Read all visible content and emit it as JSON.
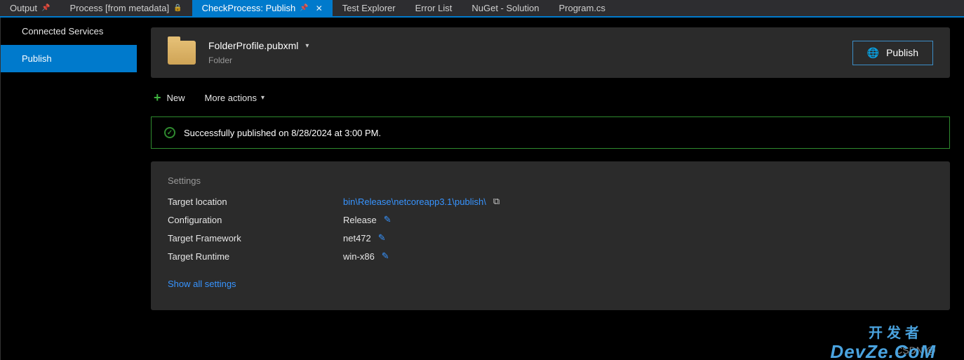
{
  "tabs": {
    "output": "Output",
    "process": "Process [from metadata]",
    "activeTab": "CheckProcess: Publish",
    "testExplorer": "Test Explorer",
    "errorList": "Error List",
    "nuget": "NuGet - Solution",
    "program": "Program.cs"
  },
  "sidebar": {
    "connected": "Connected Services",
    "publish": "Publish"
  },
  "profile": {
    "file": "FolderProfile.pubxml",
    "type": "Folder",
    "button": "Publish"
  },
  "toolbar": {
    "new": "New",
    "more": "More actions"
  },
  "banner": {
    "text": "Successfully published on 8/28/2024 at 3:00 PM."
  },
  "settings": {
    "title": "Settings",
    "targetLocationLabel": "Target location",
    "targetLocationValue": "bin\\Release\\netcoreapp3.1\\publish\\",
    "configurationLabel": "Configuration",
    "configurationValue": "Release",
    "targetFrameworkLabel": "Target Framework",
    "targetFrameworkValue": "net472",
    "targetRuntimeLabel": "Target Runtime",
    "targetRuntimeValue": "win-x86",
    "showAll": "Show all settings"
  },
  "watermark": {
    "csdn": "CSDN @",
    "main": "DevZe.CoM",
    "top": "开发者"
  }
}
